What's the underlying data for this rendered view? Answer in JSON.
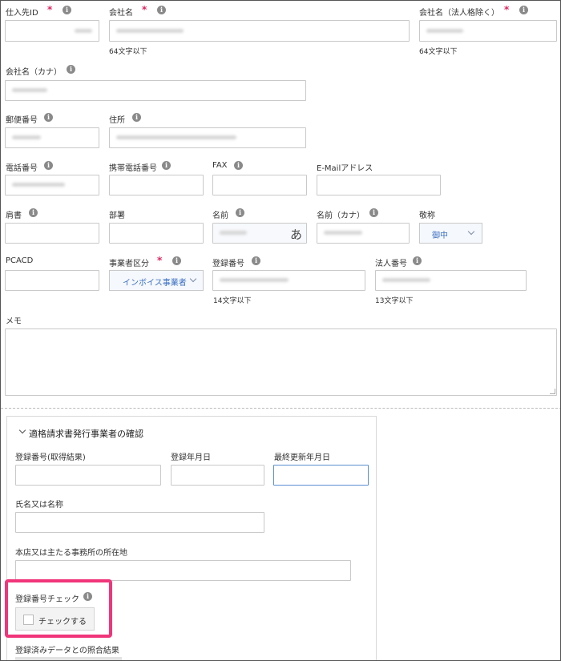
{
  "form": {
    "supplier_id": {
      "label": "仕入先ID",
      "req": "*"
    },
    "company": {
      "label": "会社名",
      "req": "*",
      "note": "64文字以下"
    },
    "company_short": {
      "label": "会社名（法人格除く）",
      "req": "*",
      "note": "64文字以下"
    },
    "company_kana": {
      "label": "会社名（カナ）"
    },
    "postal": {
      "label": "郵便番号"
    },
    "address": {
      "label": "住所"
    },
    "phone": {
      "label": "電話番号"
    },
    "mobile": {
      "label": "携帯電話番号"
    },
    "fax": {
      "label": "FAX"
    },
    "email": {
      "label": "E-Mailアドレス"
    },
    "title": {
      "label": "肩書"
    },
    "dept": {
      "label": "部署"
    },
    "name": {
      "label": "名前",
      "ime": "あ"
    },
    "name_kana": {
      "label": "名前（カナ）"
    },
    "honorific": {
      "label": "敬称",
      "value": "御中"
    },
    "pcacd": {
      "label": "PCACD"
    },
    "biz_type": {
      "label": "事業者区分",
      "req": "*",
      "value": "インボイス事業者"
    },
    "reg_no": {
      "label": "登録番号",
      "note": "14文字以下"
    },
    "corp_no": {
      "label": "法人番号",
      "note": "13文字以下"
    },
    "memo": {
      "label": "メモ"
    }
  },
  "invoice_section": {
    "title": "適格請求書発行事業者の確認",
    "reg_result": {
      "label": "登録番号(取得結果)"
    },
    "reg_date": {
      "label": "登録年月日"
    },
    "last_update": {
      "label": "最終更新年月日"
    },
    "name": {
      "label": "氏名又は名称"
    },
    "hq_address": {
      "label": "本店又は主たる事務所の所在地"
    },
    "reg_check": {
      "label": "登録番号チェック",
      "checkbox_label": "チェックする"
    },
    "match_result": {
      "label": "登録済みデータとの照合結果"
    }
  },
  "colors": {
    "required": "#e0245e",
    "highlight": "#f0357a",
    "link": "#3a6fc4",
    "focus": "#5b8fd0"
  }
}
